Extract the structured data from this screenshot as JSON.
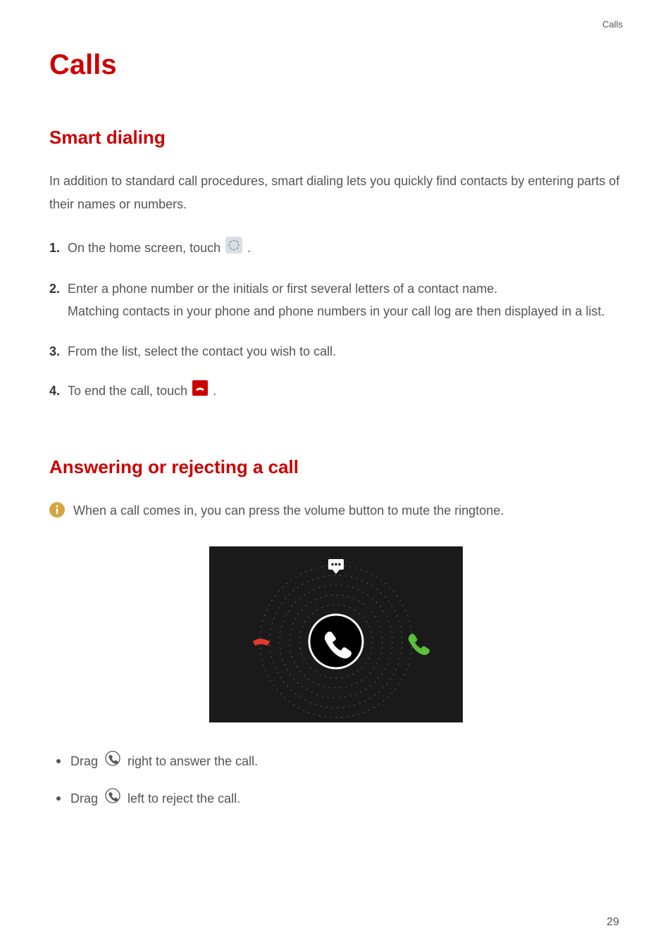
{
  "header": {
    "section_label": "Calls"
  },
  "title": "Calls",
  "sections": {
    "smart_dialing": {
      "heading": "Smart dialing",
      "intro": "In addition to standard call procedures, smart dialing lets you quickly find contacts by entering parts of their names or numbers.",
      "steps": [
        {
          "num": "1.",
          "text_before": "On the home screen, touch ",
          "icon": "dial-pad-icon",
          "text_after": "."
        },
        {
          "num": "2.",
          "text": "Enter a phone number or the initials or first several letters of a contact name.",
          "cont": "Matching contacts in your phone and phone numbers in your call log are then displayed in a list."
        },
        {
          "num": "3.",
          "text": "From the list, select the contact you wish to call."
        },
        {
          "num": "4.",
          "text_before": "To end the call, touch ",
          "icon": "hangup-icon",
          "text_after": "."
        }
      ]
    },
    "answering": {
      "heading": "Answering or rejecting a call",
      "info": "When a call comes in, you can press the volume button to mute the ringtone.",
      "bullets": [
        {
          "pre": "Drag ",
          "icon": "phone-circle-icon",
          "post": "right to answer the call."
        },
        {
          "pre": "Drag ",
          "icon": "phone-circle-icon",
          "post": "left to reject the call."
        }
      ]
    }
  },
  "page_number": "29"
}
